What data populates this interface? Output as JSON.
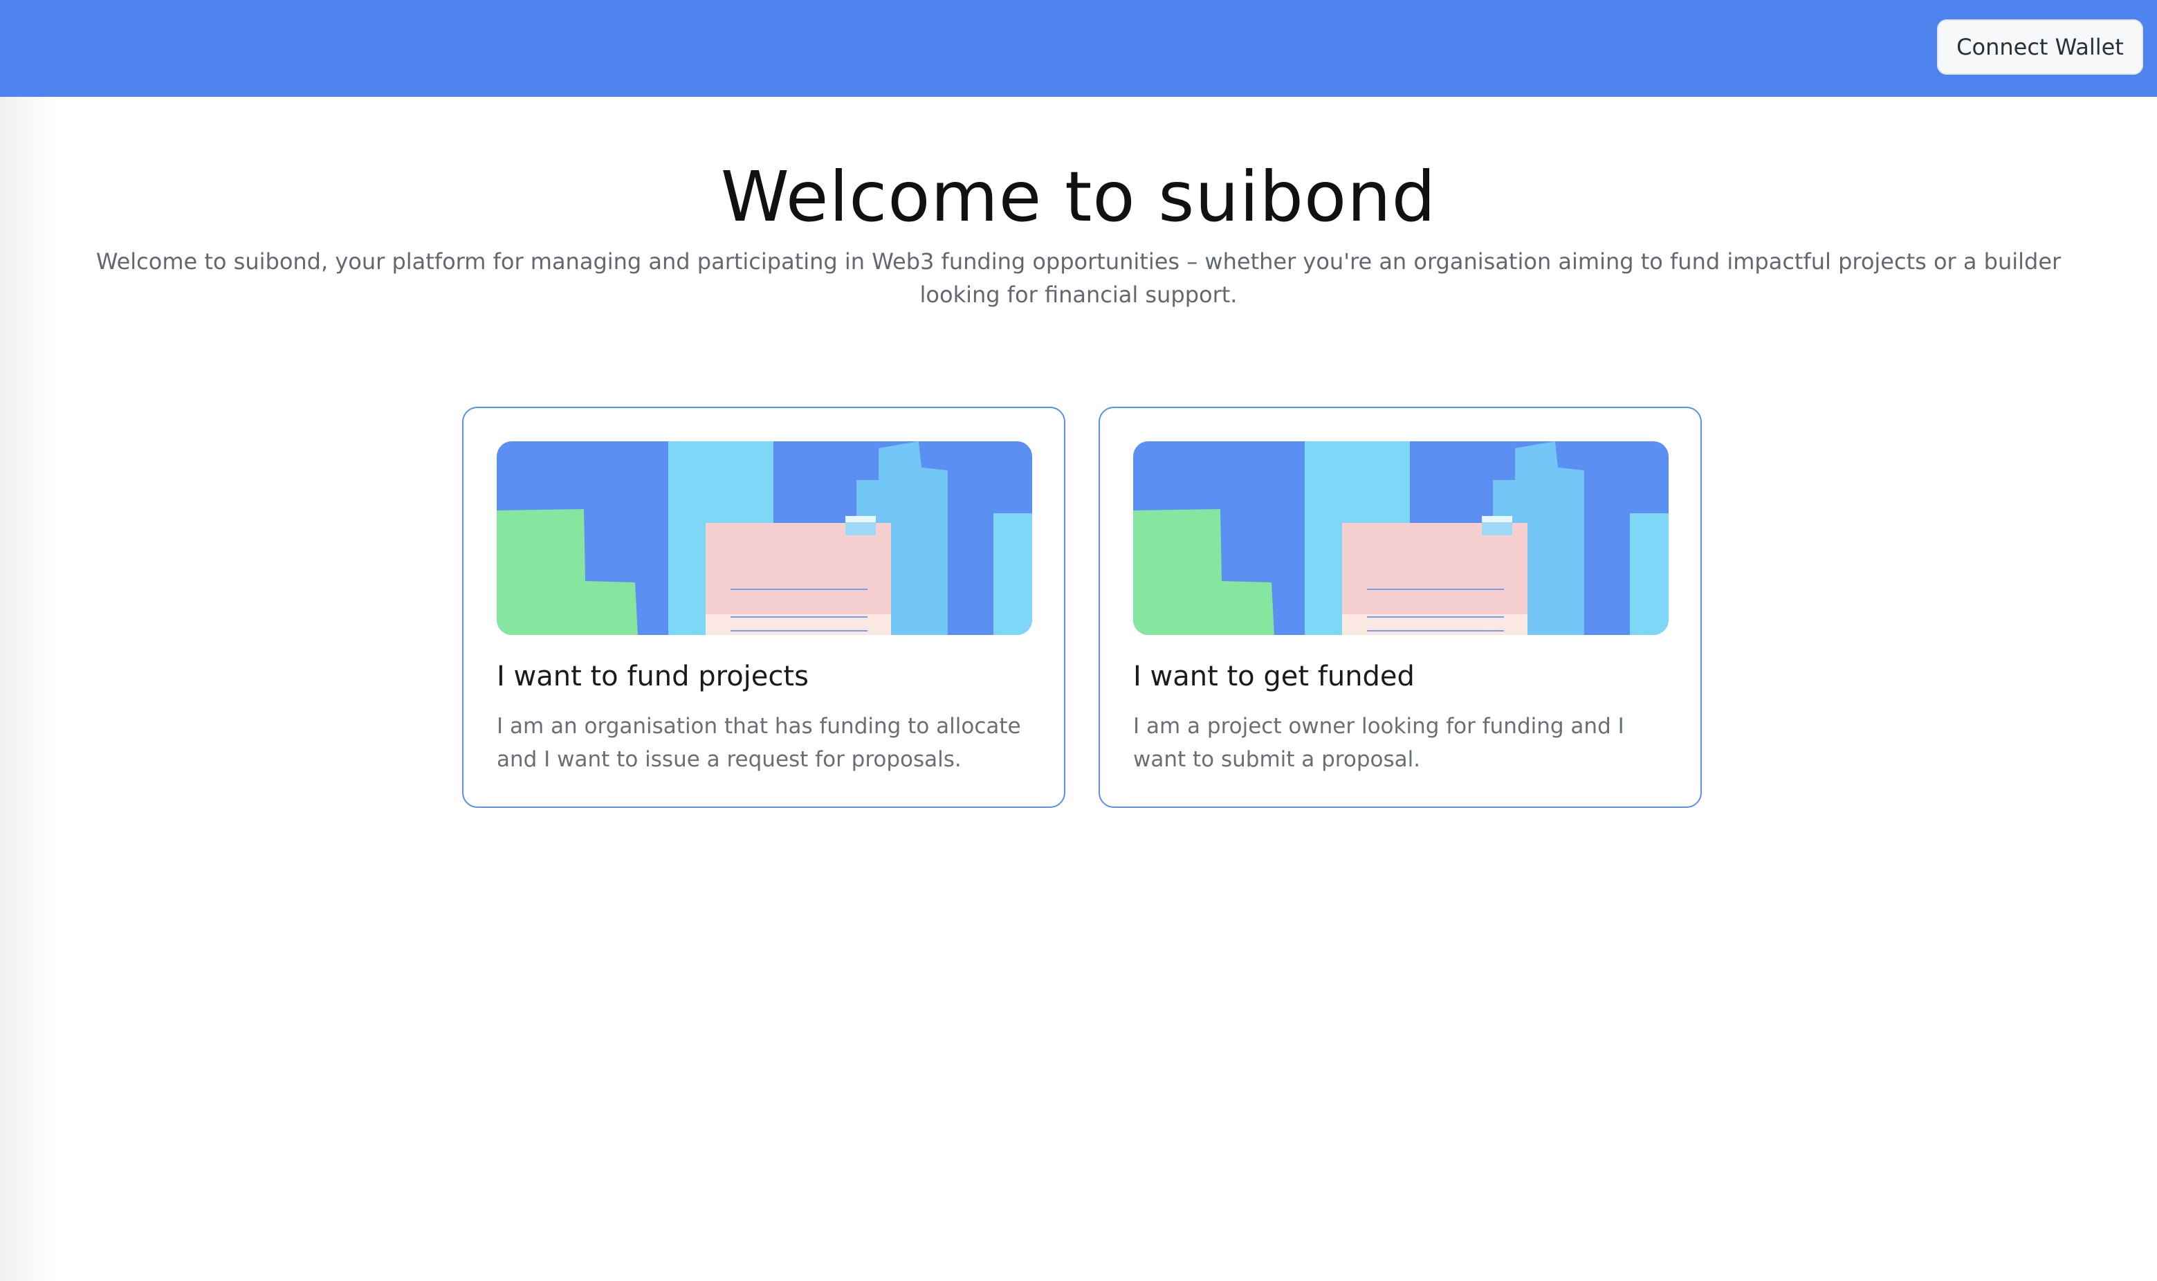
{
  "header": {
    "connect_wallet_label": "Connect Wallet",
    "bar_color": "#4f84ee"
  },
  "hero": {
    "title": "Welcome to suibond",
    "description": "Welcome to suibond, your platform for managing and participating in Web3 funding opportunities – whether you're an organisation aiming to fund impactful projects or a builder looking for financial support."
  },
  "cards": [
    {
      "title": "I want to fund projects",
      "description": "I am an organisation that has funding to allocate and I want to issue a request for proposals.",
      "image_icon": "city-illustration"
    },
    {
      "title": "I want to get funded",
      "description": "I am a project owner looking for funding and I want to submit a proposal.",
      "image_icon": "city-illustration"
    }
  ],
  "colors": {
    "accent": "#5a8ef1",
    "illustration_blue": "#5b8ff2",
    "illustration_cyan": "#7fd7f7",
    "illustration_green": "#86e59f",
    "illustration_pink": "#f6cfd0"
  }
}
